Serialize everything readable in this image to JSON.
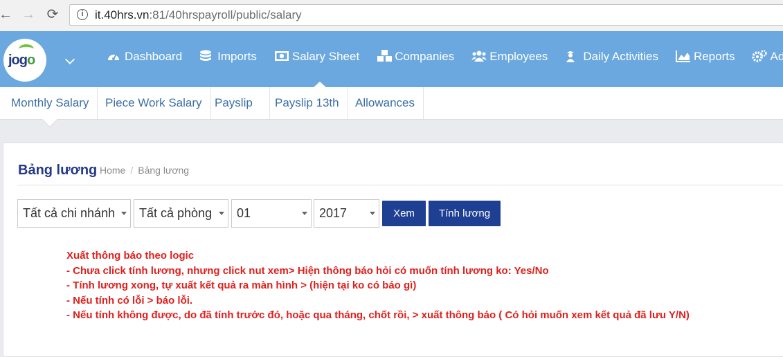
{
  "browser": {
    "url_host": "it.40hrs.vn",
    "url_rest": ":81/40hrspayroll/public/salary",
    "back_glyph": "←",
    "forward_glyph": "→",
    "reload_glyph": "⟳",
    "info_glyph": "i"
  },
  "logo": {
    "text_a": "jog",
    "text_b": "o"
  },
  "main_nav": [
    {
      "label": "Dashboard",
      "icon": "dashboard-icon"
    },
    {
      "label": "Imports",
      "icon": "database-icon"
    },
    {
      "label": "Salary Sheet",
      "icon": "money-icon"
    },
    {
      "label": "Companies",
      "icon": "cubes-icon"
    },
    {
      "label": "Employees",
      "icon": "users-icon"
    },
    {
      "label": "Daily Activities",
      "icon": "worker-icon"
    },
    {
      "label": "Reports",
      "icon": "area-chart-icon"
    },
    {
      "label": "Adm",
      "icon": "cogs-icon"
    }
  ],
  "sub_nav": [
    {
      "label": "Monthly Salary"
    },
    {
      "label": "Piece Work Salary"
    },
    {
      "label": "Payslip"
    },
    {
      "label": "Payslip 13th"
    },
    {
      "label": "Allowances"
    }
  ],
  "page": {
    "title": "Bảng lương",
    "breadcrumb_home": "Home",
    "breadcrumb_sep": "/",
    "breadcrumb_current": "Bảng lương"
  },
  "filters": {
    "branch": "Tất cả chi nhánh",
    "department": "Tất cả phòng",
    "month": "01",
    "year": "2017"
  },
  "buttons": {
    "view": "Xem",
    "calculate": "Tính lương"
  },
  "notes": [
    "Xuất thông báo theo logic",
    "- Chưa click tính lương, nhưng click nut xem> Hiện thông báo hỏi có muốn tính lương ko:  Yes/No",
    "- Tính lương xong, tự xuất kết quả ra màn hình > (hiện tại ko có báo gì)",
    "- Nếu tính có lỗi > báo lỗi.",
    "- Nếu tính không được, do đã tính trước đó, hoặc qua tháng, chốt rồi, > xuất thông báo ( Có hỏi muốn xem kết quả đã lưu Y/N)"
  ],
  "colors": {
    "header_bg": "#6aa8df",
    "button_bg": "#1f3f93",
    "title": "#233a86",
    "tab_text": "#3c6fa6",
    "note_text": "#e0201d"
  }
}
